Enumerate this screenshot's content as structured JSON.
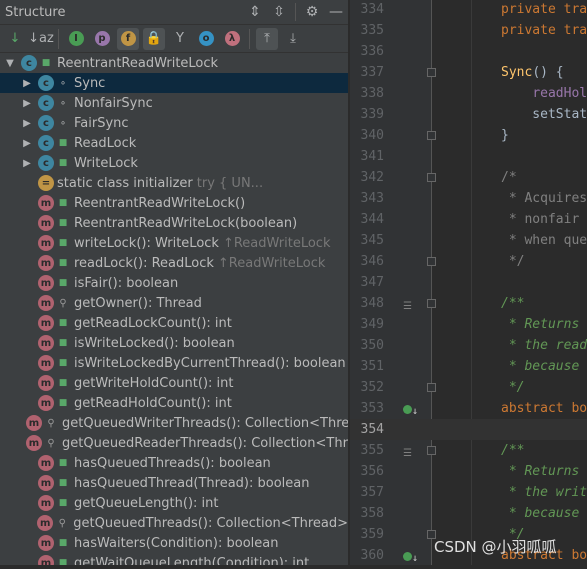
{
  "panel": {
    "title": "Structure",
    "header_icons": [
      "expand-all-icon",
      "collapse-all-icon",
      "gear-icon",
      "minimize-icon"
    ]
  },
  "toolbar": [
    {
      "name": "sort-by-visibility-button",
      "label": "↓",
      "color": "#59a869",
      "on": false
    },
    {
      "name": "sort-alphabetically-button",
      "label": "↓az",
      "color": "#afb1b3",
      "on": false
    },
    {
      "name": "show-inherited-button",
      "label": "I",
      "color": "#499c54",
      "on": false,
      "dot": true
    },
    {
      "name": "show-properties-button",
      "label": "p",
      "color": "#9876aa",
      "on": false,
      "dot": true
    },
    {
      "name": "show-fields-button",
      "label": "f",
      "color": "#c09545",
      "on": true,
      "dot": true
    },
    {
      "name": "show-non-public-button",
      "label": "🔒",
      "color": "#d9683b",
      "on": true
    },
    {
      "name": "show-lambdas-button",
      "label": "Y",
      "color": "#afb1b3",
      "on": false
    },
    {
      "name": "show-anonymous-button",
      "label": "o",
      "color": "#3592c4",
      "on": false,
      "dot": true
    },
    {
      "name": "show-lambda-button",
      "label": "λ",
      "color": "#c0707d",
      "on": false,
      "dot": true
    },
    {
      "name": "autoscroll-to-source-button",
      "label": "⤒",
      "color": "#afb1b3",
      "on": true
    },
    {
      "name": "autoscroll-from-source-button",
      "label": "⤓",
      "color": "#afb1b3",
      "on": false
    }
  ],
  "tree": [
    {
      "level": 0,
      "arrow": "▼",
      "icon": "c",
      "access": "pub",
      "name": "ReentrantReadWriteLock"
    },
    {
      "level": 1,
      "arrow": "▶",
      "icon": "c",
      "access": "pkg",
      "name": "Sync",
      "selected": true
    },
    {
      "level": 1,
      "arrow": "▶",
      "icon": "c",
      "access": "pkg",
      "name": "NonfairSync"
    },
    {
      "level": 1,
      "arrow": "▶",
      "icon": "c",
      "access": "pkg",
      "name": "FairSync"
    },
    {
      "level": 1,
      "arrow": "▶",
      "icon": "c",
      "access": "pub",
      "name": "ReadLock"
    },
    {
      "level": 1,
      "arrow": "▶",
      "icon": "c",
      "access": "pub",
      "name": "WriteLock"
    },
    {
      "level": 1,
      "icon": "i",
      "access": "",
      "name": "static class initializer",
      "gray": "try {            UN..."
    },
    {
      "level": 1,
      "icon": "m",
      "access": "pub",
      "name": "ReentrantReadWriteLock()"
    },
    {
      "level": 1,
      "icon": "m",
      "access": "pub",
      "name": "ReentrantReadWriteLock(boolean)"
    },
    {
      "level": 1,
      "icon": "m",
      "access": "pub",
      "name": "writeLock(): WriteLock",
      "gray": "↑ReadWriteLock"
    },
    {
      "level": 1,
      "icon": "m",
      "access": "pub",
      "name": "readLock(): ReadLock",
      "gray": "↑ReadWriteLock"
    },
    {
      "level": 1,
      "icon": "m",
      "access": "pub",
      "name": "isFair(): boolean"
    },
    {
      "level": 1,
      "icon": "m",
      "access": "prot",
      "name": "getOwner(): Thread"
    },
    {
      "level": 1,
      "icon": "m",
      "access": "pub",
      "name": "getReadLockCount(): int"
    },
    {
      "level": 1,
      "icon": "m",
      "access": "pub",
      "name": "isWriteLocked(): boolean"
    },
    {
      "level": 1,
      "icon": "m",
      "access": "pub",
      "name": "isWriteLockedByCurrentThread(): boolean"
    },
    {
      "level": 1,
      "icon": "m",
      "access": "pub",
      "name": "getWriteHoldCount(): int"
    },
    {
      "level": 1,
      "icon": "m",
      "access": "pub",
      "name": "getReadHoldCount(): int"
    },
    {
      "level": 1,
      "icon": "m",
      "access": "prot",
      "name": "getQueuedWriterThreads(): Collection<Thread>"
    },
    {
      "level": 1,
      "icon": "m",
      "access": "prot",
      "name": "getQueuedReaderThreads(): Collection<Thread>"
    },
    {
      "level": 1,
      "icon": "m",
      "access": "pub",
      "name": "hasQueuedThreads(): boolean"
    },
    {
      "level": 1,
      "icon": "m",
      "access": "pub",
      "name": "hasQueuedThread(Thread): boolean"
    },
    {
      "level": 1,
      "icon": "m",
      "access": "pub",
      "name": "getQueueLength(): int"
    },
    {
      "level": 1,
      "icon": "m",
      "access": "prot",
      "name": "getQueuedThreads(): Collection<Thread>"
    },
    {
      "level": 1,
      "icon": "m",
      "access": "pub",
      "name": "hasWaiters(Condition): boolean"
    },
    {
      "level": 1,
      "icon": "m",
      "access": "pub",
      "name": "getWaitQueueLength(Condition): int"
    }
  ],
  "editor": {
    "current_line": "354",
    "lines": [
      {
        "n": "334",
        "seg": [
          [
            "kw",
            "private tra"
          ]
        ]
      },
      {
        "n": "335",
        "seg": [
          [
            "kw",
            "private tra"
          ]
        ]
      },
      {
        "n": "336",
        "seg": []
      },
      {
        "n": "337",
        "fold": true,
        "seg": [
          [
            "fn",
            "Sync"
          ],
          [
            "pl",
            "() {"
          ]
        ]
      },
      {
        "n": "338",
        "seg": [
          [
            "pl",
            "    "
          ],
          [
            "fld",
            "readHol"
          ]
        ]
      },
      {
        "n": "339",
        "seg": [
          [
            "pl",
            "    setStat"
          ]
        ]
      },
      {
        "n": "340",
        "fold": true,
        "seg": [
          [
            "pl",
            "}"
          ]
        ]
      },
      {
        "n": "341",
        "seg": []
      },
      {
        "n": "342",
        "fold": true,
        "seg": [
          [
            "cmt",
            "/*"
          ]
        ]
      },
      {
        "n": "343",
        "seg": [
          [
            "cmt",
            " * Acquires"
          ]
        ]
      },
      {
        "n": "344",
        "seg": [
          [
            "cmt",
            " * nonfair "
          ]
        ]
      },
      {
        "n": "345",
        "seg": [
          [
            "cmt",
            " * when que"
          ]
        ]
      },
      {
        "n": "346",
        "fold": true,
        "seg": [
          [
            "cmt",
            " */"
          ]
        ]
      },
      {
        "n": "347",
        "seg": []
      },
      {
        "n": "348",
        "fold": true,
        "mark": "doc",
        "seg": [
          [
            "doc",
            "/**"
          ]
        ]
      },
      {
        "n": "349",
        "seg": [
          [
            "doc",
            " * Returns "
          ]
        ]
      },
      {
        "n": "350",
        "seg": [
          [
            "doc",
            " * the read"
          ]
        ]
      },
      {
        "n": "351",
        "seg": [
          [
            "doc",
            " * because "
          ]
        ]
      },
      {
        "n": "352",
        "fold": true,
        "seg": [
          [
            "doc",
            " */"
          ]
        ]
      },
      {
        "n": "353",
        "mark": "impl",
        "seg": [
          [
            "kw",
            "abstract bo"
          ]
        ]
      },
      {
        "n": "354",
        "seg": []
      },
      {
        "n": "355",
        "fold": true,
        "mark": "doc",
        "seg": [
          [
            "doc",
            "/**"
          ]
        ]
      },
      {
        "n": "356",
        "seg": [
          [
            "doc",
            " * Returns "
          ]
        ]
      },
      {
        "n": "357",
        "seg": [
          [
            "doc",
            " * the writ"
          ]
        ]
      },
      {
        "n": "358",
        "seg": [
          [
            "doc",
            " * because "
          ]
        ]
      },
      {
        "n": "359",
        "fold": true,
        "seg": [
          [
            "doc",
            " */"
          ]
        ]
      },
      {
        "n": "360",
        "mark": "impl",
        "seg": [
          [
            "kw",
            "abstract bo"
          ]
        ]
      }
    ]
  },
  "watermark": "CSDN @小羽呱呱",
  "colors": {
    "panel_bg": "#3c3f41",
    "selection": "#0d293e",
    "editor_bg": "#2b2b2b",
    "keyword": "#cc7832",
    "doc_comment": "#629755"
  }
}
